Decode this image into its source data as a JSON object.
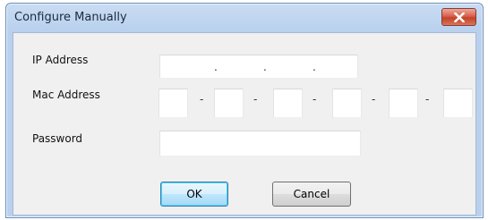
{
  "window": {
    "title": "Configure Manually",
    "close_icon": "close-icon"
  },
  "form": {
    "ip": {
      "label": "IP Address",
      "separator": ".",
      "value": ""
    },
    "mac": {
      "label": "Mac Address",
      "separator": "-",
      "value": ""
    },
    "password": {
      "label": "Password",
      "value": ""
    }
  },
  "buttons": {
    "ok_label": "OK",
    "cancel_label": "Cancel"
  },
  "colors": {
    "title_bar": "#b9d1ee",
    "close_button": "#c44227",
    "default_button_border": "#3c7fb1",
    "dialog_background": "#f0f0f0"
  }
}
